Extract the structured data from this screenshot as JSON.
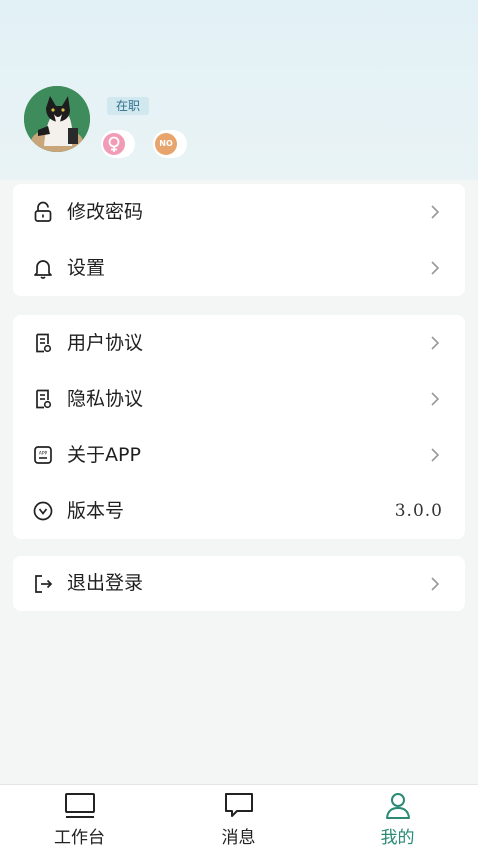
{
  "profile": {
    "status_tag": "在职",
    "badge2_text": "NO"
  },
  "menu_group1": [
    {
      "label": "修改密码",
      "icon": "unlock-icon"
    },
    {
      "label": "设置",
      "icon": "bell-icon"
    }
  ],
  "menu_group2": [
    {
      "label": "用户协议",
      "icon": "document-icon"
    },
    {
      "label": "隐私协议",
      "icon": "document-icon"
    },
    {
      "label": "关于APP",
      "icon": "app-info-icon"
    },
    {
      "label": "版本号",
      "icon": "chevron-circle-icon",
      "value": "3.0.0"
    }
  ],
  "menu_group3": [
    {
      "label": "退出登录",
      "icon": "logout-icon"
    }
  ],
  "tabbar": {
    "tabs": [
      {
        "label": "工作台",
        "icon": "monitor-icon",
        "active": false
      },
      {
        "label": "消息",
        "icon": "message-icon",
        "active": false
      },
      {
        "label": "我的",
        "icon": "user-icon",
        "active": true
      }
    ]
  },
  "colors": {
    "accent": "#2a8a74",
    "header_bg": "#e2f1f6",
    "page_bg": "#f4f6f6",
    "tag_bg": "#d2e8ef"
  }
}
